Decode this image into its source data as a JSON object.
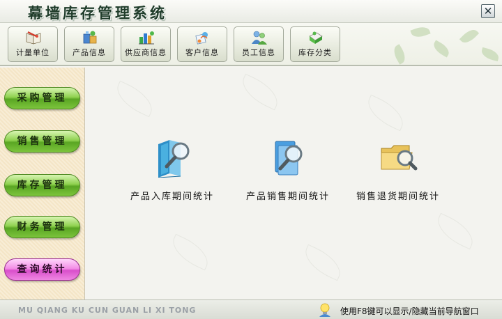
{
  "window": {
    "title": "幕墙库存管理系统",
    "close_label": "✕"
  },
  "toolbar": {
    "items": [
      {
        "label": "计量单位",
        "icon": "measure-book-icon"
      },
      {
        "label": "产品信息",
        "icon": "product-info-icon"
      },
      {
        "label": "供应商信息",
        "icon": "supplier-icon"
      },
      {
        "label": "客户信息",
        "icon": "customer-icon"
      },
      {
        "label": "员工信息",
        "icon": "employee-icon"
      },
      {
        "label": "库存分类",
        "icon": "stock-category-icon"
      }
    ]
  },
  "sidebar": {
    "items": [
      {
        "label": "采购管理",
        "active": false
      },
      {
        "label": "销售管理",
        "active": false
      },
      {
        "label": "库存管理",
        "active": false
      },
      {
        "label": "财务管理",
        "active": false
      },
      {
        "label": "查询统计",
        "active": true
      }
    ]
  },
  "main": {
    "items": [
      {
        "label": "产品入库期间统计",
        "icon": "book-search-icon"
      },
      {
        "label": "产品销售期间统计",
        "icon": "document-search-icon"
      },
      {
        "label": "销售退货期间统计",
        "icon": "folder-search-icon"
      }
    ]
  },
  "statusbar": {
    "pinyin": "MU QIANG KU CUN  GUAN LI XI TONG",
    "hint": "使用F8键可以显示/隐藏当前导航窗口",
    "hint_icon": "lightbulb-user-icon"
  },
  "colors": {
    "green_button": "#7cc43c",
    "active_button": "#ef86e2",
    "title_text": "#1f3c2a"
  }
}
